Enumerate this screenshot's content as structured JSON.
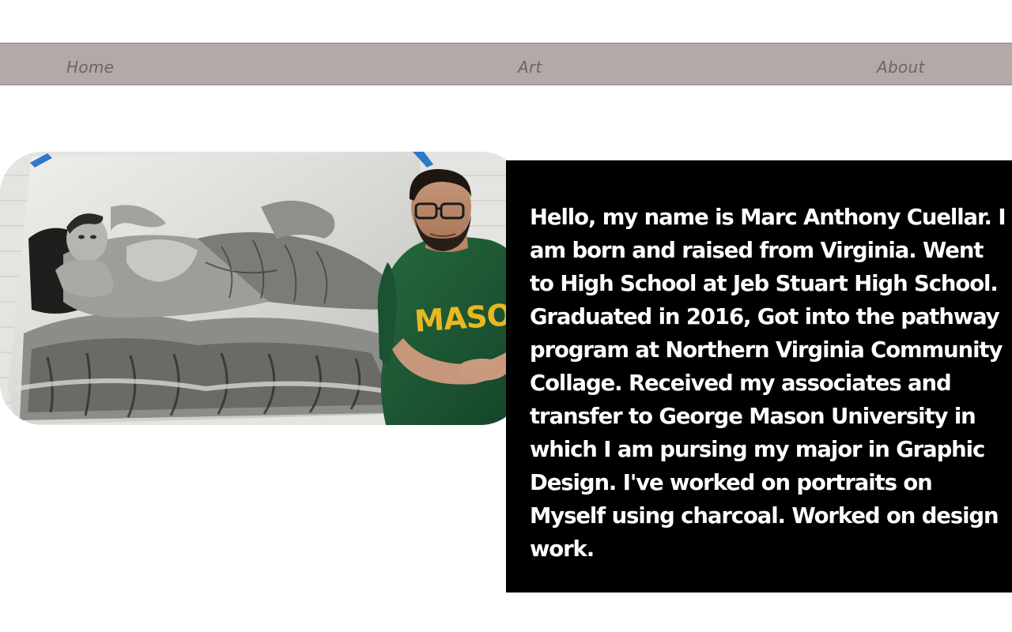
{
  "nav": {
    "home_label": "Home",
    "art_label": "Art",
    "about_label": "About"
  },
  "photo": {
    "shirt_text": "MASON",
    "shirt_color": "#1f5a33",
    "shirt_text_color": "#e8b821"
  },
  "bio": {
    "text": "Hello, my name is Marc Anthony Cuellar. I am born and raised from Virginia. Went to High School at Jeb Stuart High School. Graduated in 2016, Got into the pathway program at Northern Virginia Community Collage. Received my associates and transfer to George Mason University in which I am pursing my major in Graphic Design. I've worked on portraits on Myself using charcoal. Worked on design work."
  },
  "colors": {
    "nav_background": "#b3a9a9",
    "nav_text": "#6d6565",
    "bio_background": "#000000",
    "bio_text": "#ffffff"
  }
}
